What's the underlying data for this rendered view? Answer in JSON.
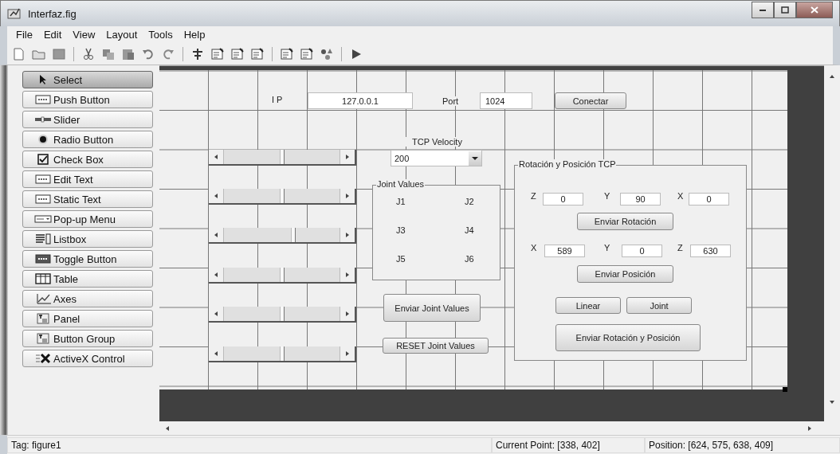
{
  "window": {
    "title": "Interfaz.fig"
  },
  "menu": [
    "File",
    "Edit",
    "View",
    "Layout",
    "Tools",
    "Help"
  ],
  "palette": [
    {
      "label": "Select",
      "selected": true
    },
    {
      "label": "Push Button",
      "selected": false
    },
    {
      "label": "Slider",
      "selected": false
    },
    {
      "label": "Radio Button",
      "selected": false
    },
    {
      "label": "Check Box",
      "selected": false
    },
    {
      "label": "Edit Text",
      "selected": false
    },
    {
      "label": "Static Text",
      "selected": false
    },
    {
      "label": "Pop-up Menu",
      "selected": false
    },
    {
      "label": "Listbox",
      "selected": false
    },
    {
      "label": "Toggle Button",
      "selected": false
    },
    {
      "label": "Table",
      "selected": false
    },
    {
      "label": "Axes",
      "selected": false
    },
    {
      "label": "Panel",
      "selected": false
    },
    {
      "label": "Button Group",
      "selected": false
    },
    {
      "label": "ActiveX Control",
      "selected": false
    }
  ],
  "figure": {
    "connection": {
      "ip_label": "IP",
      "ip_value": "127.0.0.1",
      "port_label": "Port",
      "port_value": "1024",
      "connect_button": "Conectar"
    },
    "velocity": {
      "label": "TCP Velocity",
      "value": "200"
    },
    "sliders": [
      {
        "level": 0.5
      },
      {
        "level": 0.5
      },
      {
        "level": 0.6
      },
      {
        "level": 0.5
      },
      {
        "level": 0.5
      },
      {
        "level": 0.5
      }
    ],
    "joint_panel": {
      "title": "Joint Values",
      "labels": [
        "J1",
        "J2",
        "J3",
        "J4",
        "J5",
        "J6"
      ]
    },
    "joint_buttons": [
      "Enviar Joint Values",
      "RESET Joint Values"
    ],
    "tcp_panel": {
      "title": "Rotación y Posición TCP",
      "rotation": [
        {
          "axis": "Z",
          "value": "0"
        },
        {
          "axis": "Y",
          "value": "90"
        },
        {
          "axis": "X",
          "value": "0"
        }
      ],
      "rotation_button": "Enviar Rotación",
      "position": [
        {
          "axis": "X",
          "value": "589"
        },
        {
          "axis": "Y",
          "value": "0"
        },
        {
          "axis": "Z",
          "value": "630"
        }
      ],
      "position_button": "Enviar Posición",
      "mode_buttons": [
        "Linear",
        "Joint"
      ],
      "send_button": "Enviar Rotación y Posición"
    }
  },
  "status_bar": {
    "tag": "Tag: figure1",
    "current_point": "Current Point:  [338, 402]",
    "position": "Position: [624, 575, 638, 409]"
  }
}
